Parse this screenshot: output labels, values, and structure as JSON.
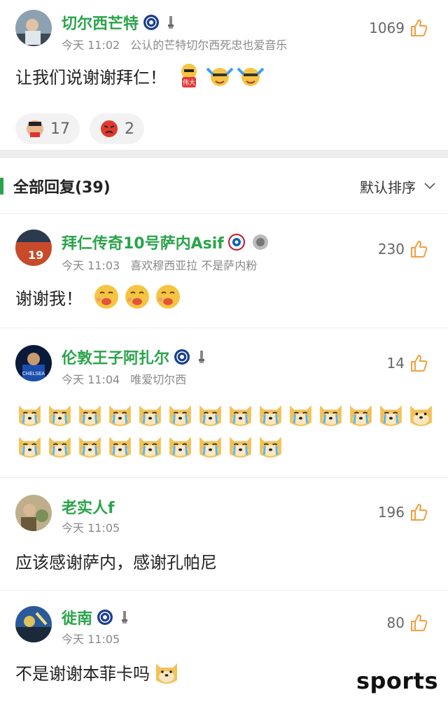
{
  "top_post": {
    "username": "切尔西芒特",
    "time": "今天 11:02",
    "signature": "公认的芒特切尔西死忠也爱音乐",
    "likes": "1069",
    "text": "让我们说谢谢拜仁！",
    "reactions": [
      {
        "icon": "player-face-emoji",
        "count": "17"
      },
      {
        "icon": "angry-face-emoji",
        "count": "2"
      }
    ]
  },
  "replies_header": {
    "title": "全部回复(39)",
    "sort_label": "默认排序"
  },
  "comments": [
    {
      "username": "拜仁传奇10号萨内Asif",
      "time": "今天 11:03",
      "signature": "喜欢穆西亚拉 不是萨内粉",
      "likes": "230",
      "text": "谢谢我！"
    },
    {
      "username": "伦敦王子阿扎尔",
      "time": "今天 11:04",
      "signature": "唯爱切尔西",
      "likes": "14",
      "text": ""
    },
    {
      "username": "老实人f",
      "time": "今天 11:05",
      "signature": "",
      "likes": "196",
      "text": "应该感谢萨内，感谢孔帕尼"
    },
    {
      "username": "徙南",
      "time": "今天 11:05",
      "signature": "",
      "likes": "80",
      "text": "不是谢谢本菲卡吗"
    }
  ],
  "watermark": "sports",
  "colors": {
    "username_green": "#2aa44a",
    "like_orange": "#f0a040"
  }
}
